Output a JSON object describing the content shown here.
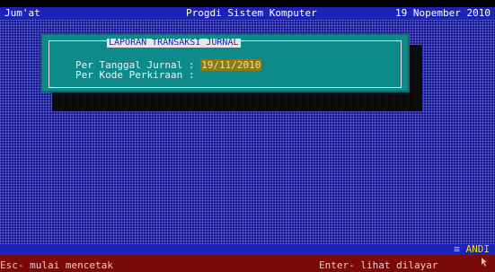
{
  "topbar": {
    "day": "Jum'at",
    "title": "Progdi Sistem Komputer",
    "date": "19 Nopember 2010"
  },
  "dialog": {
    "title": "LAPORAN TRANSAKSI JURNAL",
    "fields": [
      {
        "label": "Per Tanggal Jurnal",
        "separator": ":",
        "value": "19/11/2010"
      },
      {
        "label": "Per Kode Perkiraan",
        "separator": ":",
        "value": ""
      }
    ]
  },
  "status": {
    "brand": "≡ ANDI"
  },
  "hints": {
    "left": "Esc- mulai mencetak",
    "right": "Enter- lihat dilayar"
  },
  "colors": {
    "topbar": "#1c23b8",
    "desktop": "#15189a",
    "dialog": "#0f8a8a",
    "hintbar": "#7a0a0a",
    "highlight": "#8a7a1a",
    "brand": "#e8e020"
  },
  "icons": {
    "cursor": "mouse-cursor-icon"
  }
}
